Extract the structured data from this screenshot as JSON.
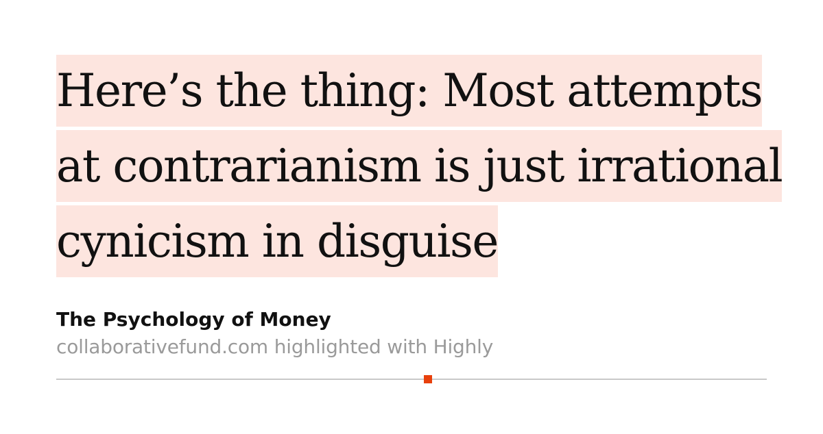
{
  "highlight": {
    "text": "Here’s the thing: Most attempts at contrarianism is just irrational cynicism in disguise",
    "highlight_color": "#fde5df"
  },
  "source": {
    "title": "The Psychology of Money",
    "subtitle": "collaborativefund.com highlighted with Highly"
  },
  "marker_color": "#e8400c"
}
